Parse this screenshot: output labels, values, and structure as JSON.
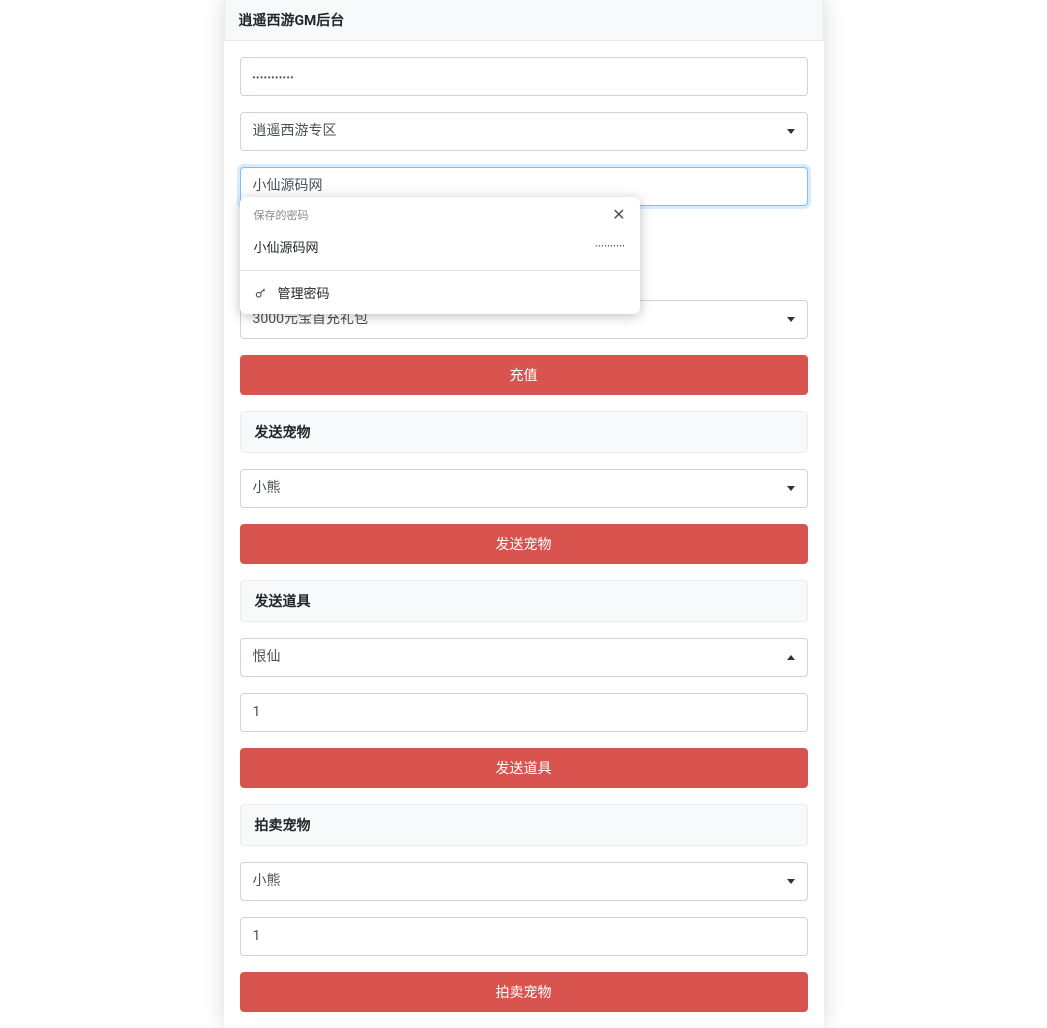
{
  "header": {
    "title": "逍遥西游GM后台"
  },
  "form": {
    "password_value": "•••••••••••",
    "region_value": "逍遥西游专区",
    "username_value": "小仙源码网"
  },
  "password_popup": {
    "title": "保存的密码",
    "item_user": "小仙源码网",
    "item_pass": "••••••••••",
    "manage_label": "管理密码"
  },
  "recharge": {
    "package_value": "3000元宝首充礼包",
    "button": "充值"
  },
  "send_pet": {
    "section_title": "发送宠物",
    "pet_value": "小熊",
    "button": "发送宠物"
  },
  "send_item": {
    "section_title": "发送道具",
    "item_value": "恨仙",
    "qty_value": "1",
    "button": "发送道具"
  },
  "auction_pet": {
    "section_title": "拍卖宠物",
    "pet_value": "小熊",
    "qty_value": "1",
    "button": "拍卖宠物"
  }
}
